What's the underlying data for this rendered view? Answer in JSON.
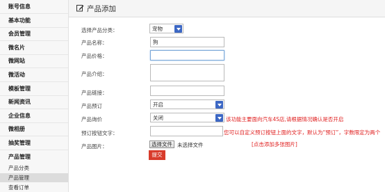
{
  "sidebar": {
    "items": [
      {
        "label": "账号信息"
      },
      {
        "label": "基本功能"
      },
      {
        "label": "会员管理"
      },
      {
        "label": "微名片"
      },
      {
        "label": "微网站"
      },
      {
        "label": "微活动"
      },
      {
        "label": "模板管理"
      },
      {
        "label": "新闻资讯"
      },
      {
        "label": "企业信息"
      },
      {
        "label": "微相册"
      },
      {
        "label": "抽奖管理"
      },
      {
        "label": "产品管理"
      }
    ],
    "sub_items": [
      {
        "label": "产品分类"
      },
      {
        "label": "产品管理",
        "active": true
      },
      {
        "label": "查看订单"
      }
    ]
  },
  "header": {
    "title": "产品添加",
    "icon": "edit-icon"
  },
  "form": {
    "category": {
      "label": "选择产品分类：",
      "value": "宠物"
    },
    "name": {
      "label": "产品名称：",
      "value": "狗"
    },
    "price": {
      "label": "产品价格：",
      "value": ""
    },
    "intro": {
      "label": "产品介绍：",
      "value": ""
    },
    "link": {
      "label": "产品链接：",
      "value": ""
    },
    "booking": {
      "label": "产品预订",
      "value": "开启",
      "hint": "该功能主要面向汽车4S店,请根据情况确认是否开启"
    },
    "inquiry": {
      "label": "产品询价",
      "value": "关闭"
    },
    "button_text": {
      "label": "预订按钮文字：",
      "value": "",
      "hint": "您可以自定义预订按钮上面的文字，默认为“预订”，字数限定为两个"
    },
    "image": {
      "label": "产品图片：",
      "button": "选择文件",
      "status": "未选择文件",
      "link": "[点击添加多张图片]"
    },
    "submit": "提交"
  },
  "colors": {
    "accent": "#3c67c4",
    "hint": "#e02020",
    "submit": "#d83b2b"
  }
}
